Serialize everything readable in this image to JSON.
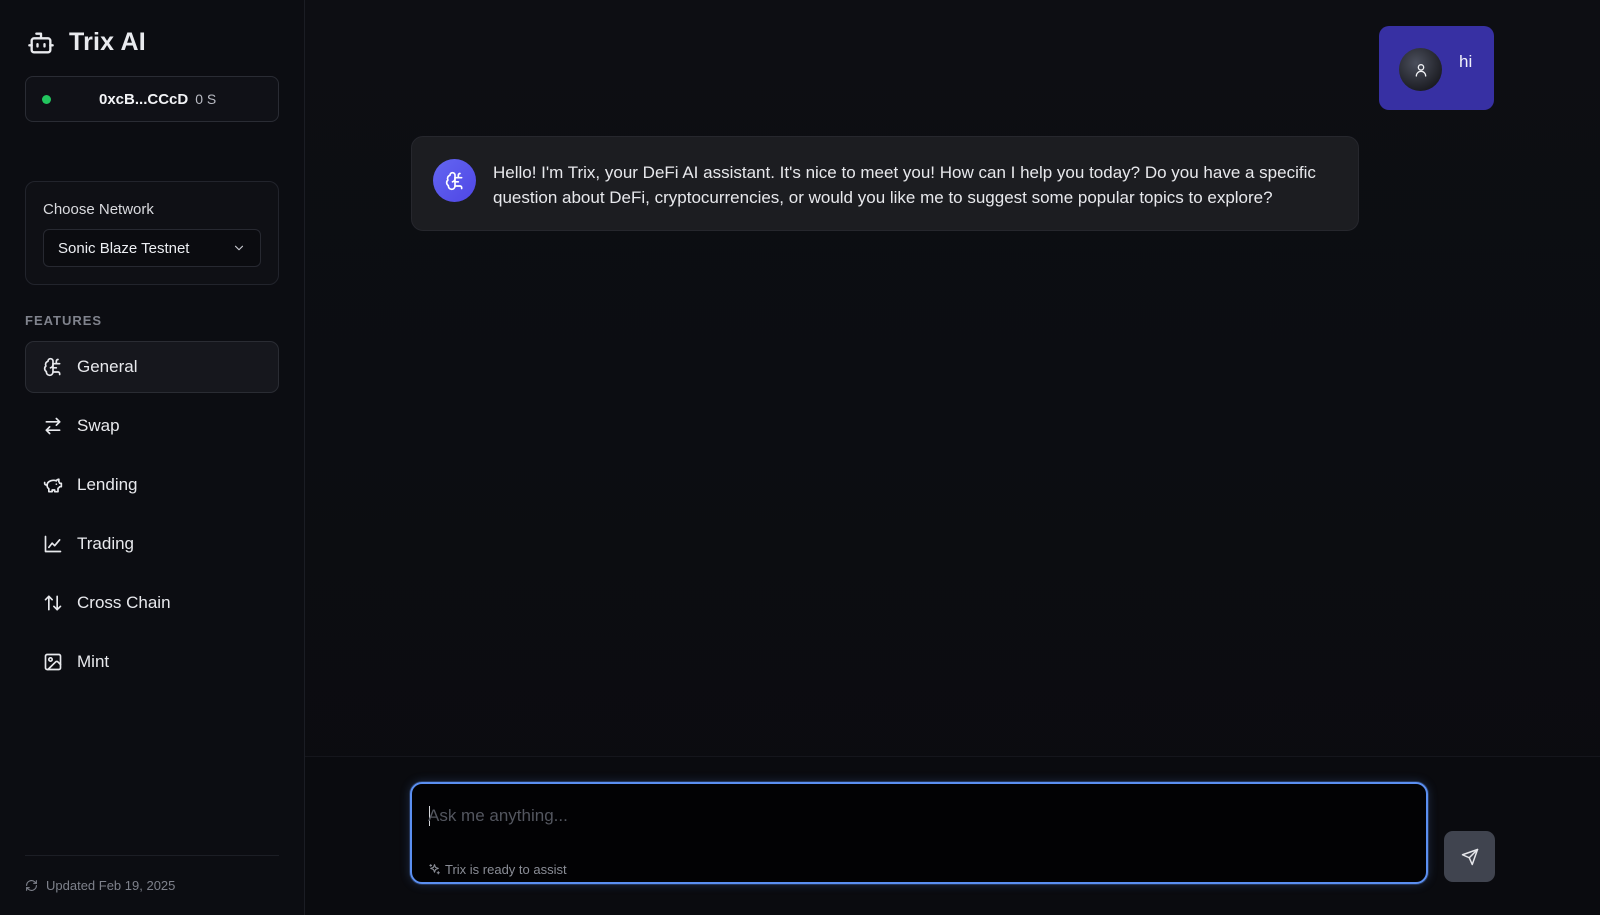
{
  "brand": {
    "title": "Trix AI",
    "icon": "bot-icon"
  },
  "wallet": {
    "address": "0xcB...CCcD",
    "balance": "0 S",
    "status_color": "#22c55e"
  },
  "network": {
    "label": "Choose Network",
    "selected": "Sonic Blaze Testnet"
  },
  "sidebar": {
    "section_label": "FEATURES",
    "items": [
      {
        "label": "General",
        "icon": "brain-icon",
        "active": true
      },
      {
        "label": "Swap",
        "icon": "swap-arrows-icon",
        "active": false
      },
      {
        "label": "Lending",
        "icon": "piggy-bank-icon",
        "active": false
      },
      {
        "label": "Trading",
        "icon": "line-chart-icon",
        "active": false
      },
      {
        "label": "Cross Chain",
        "icon": "up-down-arrows-icon",
        "active": false
      },
      {
        "label": "Mint",
        "icon": "image-icon",
        "active": false
      }
    ],
    "footer": "Updated Feb 19, 2025"
  },
  "chat": {
    "messages": [
      {
        "role": "user",
        "text": "hi"
      },
      {
        "role": "assistant",
        "text": "Hello! I'm Trix, your DeFi AI assistant. It's nice to meet you! How can I help you today? Do you have a specific question about DeFi, cryptocurrencies, or would you like me to suggest some popular topics to explore?"
      }
    ]
  },
  "composer": {
    "placeholder": "Ask me anything...",
    "value": "",
    "status": "Trix is ready to assist"
  },
  "colors": {
    "accent": "#5b8ff1",
    "user_bubble": "#3730a3",
    "bot_avatar": "#6366f1"
  }
}
